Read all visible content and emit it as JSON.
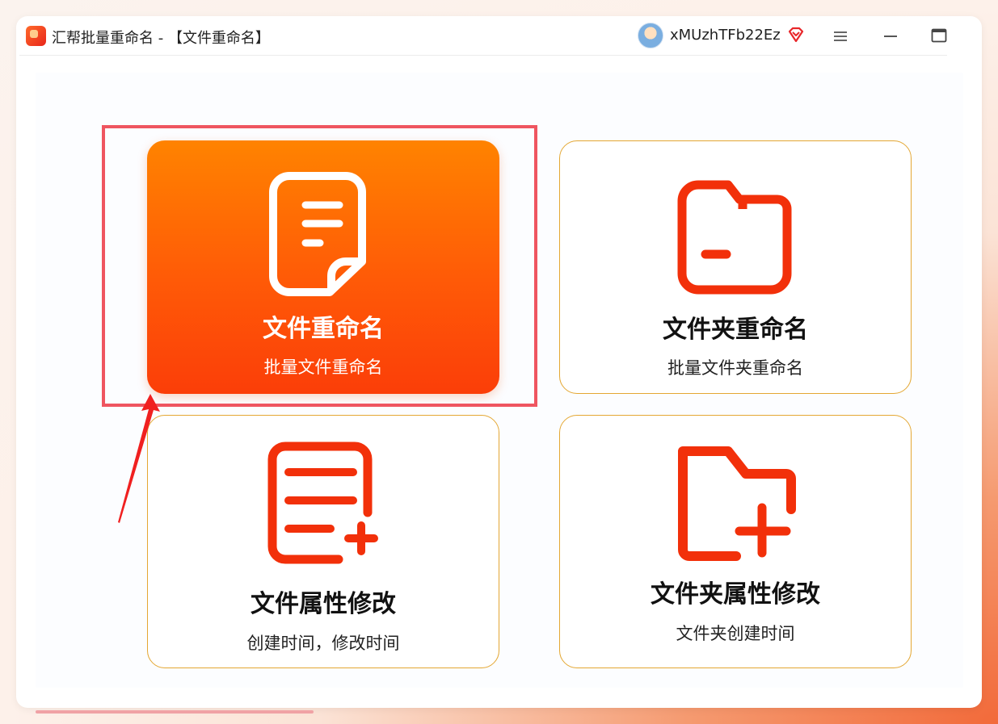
{
  "window": {
    "title": "汇帮批量重命名 - 【文件重命名】",
    "username": "xMUzhTFb22Ez"
  },
  "icons": {
    "app": "app-logo-icon",
    "avatar": "user-avatar-icon",
    "vip": "vip-diamond-icon",
    "menu": "hamburger-menu-icon",
    "minimize": "minimize-icon",
    "maximize": "maximize-icon"
  },
  "cards": [
    {
      "id": "file-rename",
      "icon": "document-icon",
      "title": "文件重命名",
      "subtitle": "批量文件重命名",
      "selected": true
    },
    {
      "id": "folder-rename",
      "icon": "folder-minus-icon",
      "title": "文件夹重命名",
      "subtitle": "批量文件夹重命名",
      "selected": false
    },
    {
      "id": "file-attributes",
      "icon": "document-add-icon",
      "title": "文件属性修改",
      "subtitle": "创建时间，修改时间",
      "selected": false
    },
    {
      "id": "folder-attributes",
      "icon": "folder-add-icon",
      "title": "文件夹属性修改",
      "subtitle": "文件夹创建时间",
      "selected": false
    }
  ],
  "colors": {
    "accent_red": "#f2300a",
    "card_border": "#e4a733",
    "active_gradient_top": "#ff8300",
    "active_gradient_bottom": "#fb3e08",
    "highlight_box": "#ef5560",
    "annotation_arrow": "#f02020"
  }
}
